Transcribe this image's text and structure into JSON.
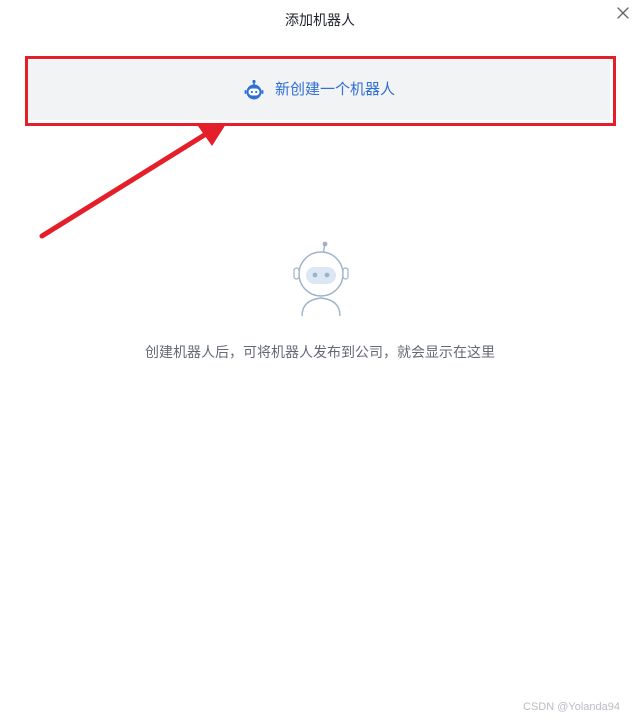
{
  "dialog": {
    "title": "添加机器人",
    "close_icon": "close-icon"
  },
  "create": {
    "label": "新创建一个机器人",
    "icon": "robot-icon",
    "accent": "#2f6fd6"
  },
  "empty_state": {
    "icon": "robot-illustration-icon",
    "text": "创建机器人后，可将机器人发布到公司，就会显示在这里"
  },
  "annotation": {
    "highlight_color": "#e41f2a",
    "arrow_icon": "arrow-icon"
  },
  "watermark": "CSDN @Yolanda94"
}
